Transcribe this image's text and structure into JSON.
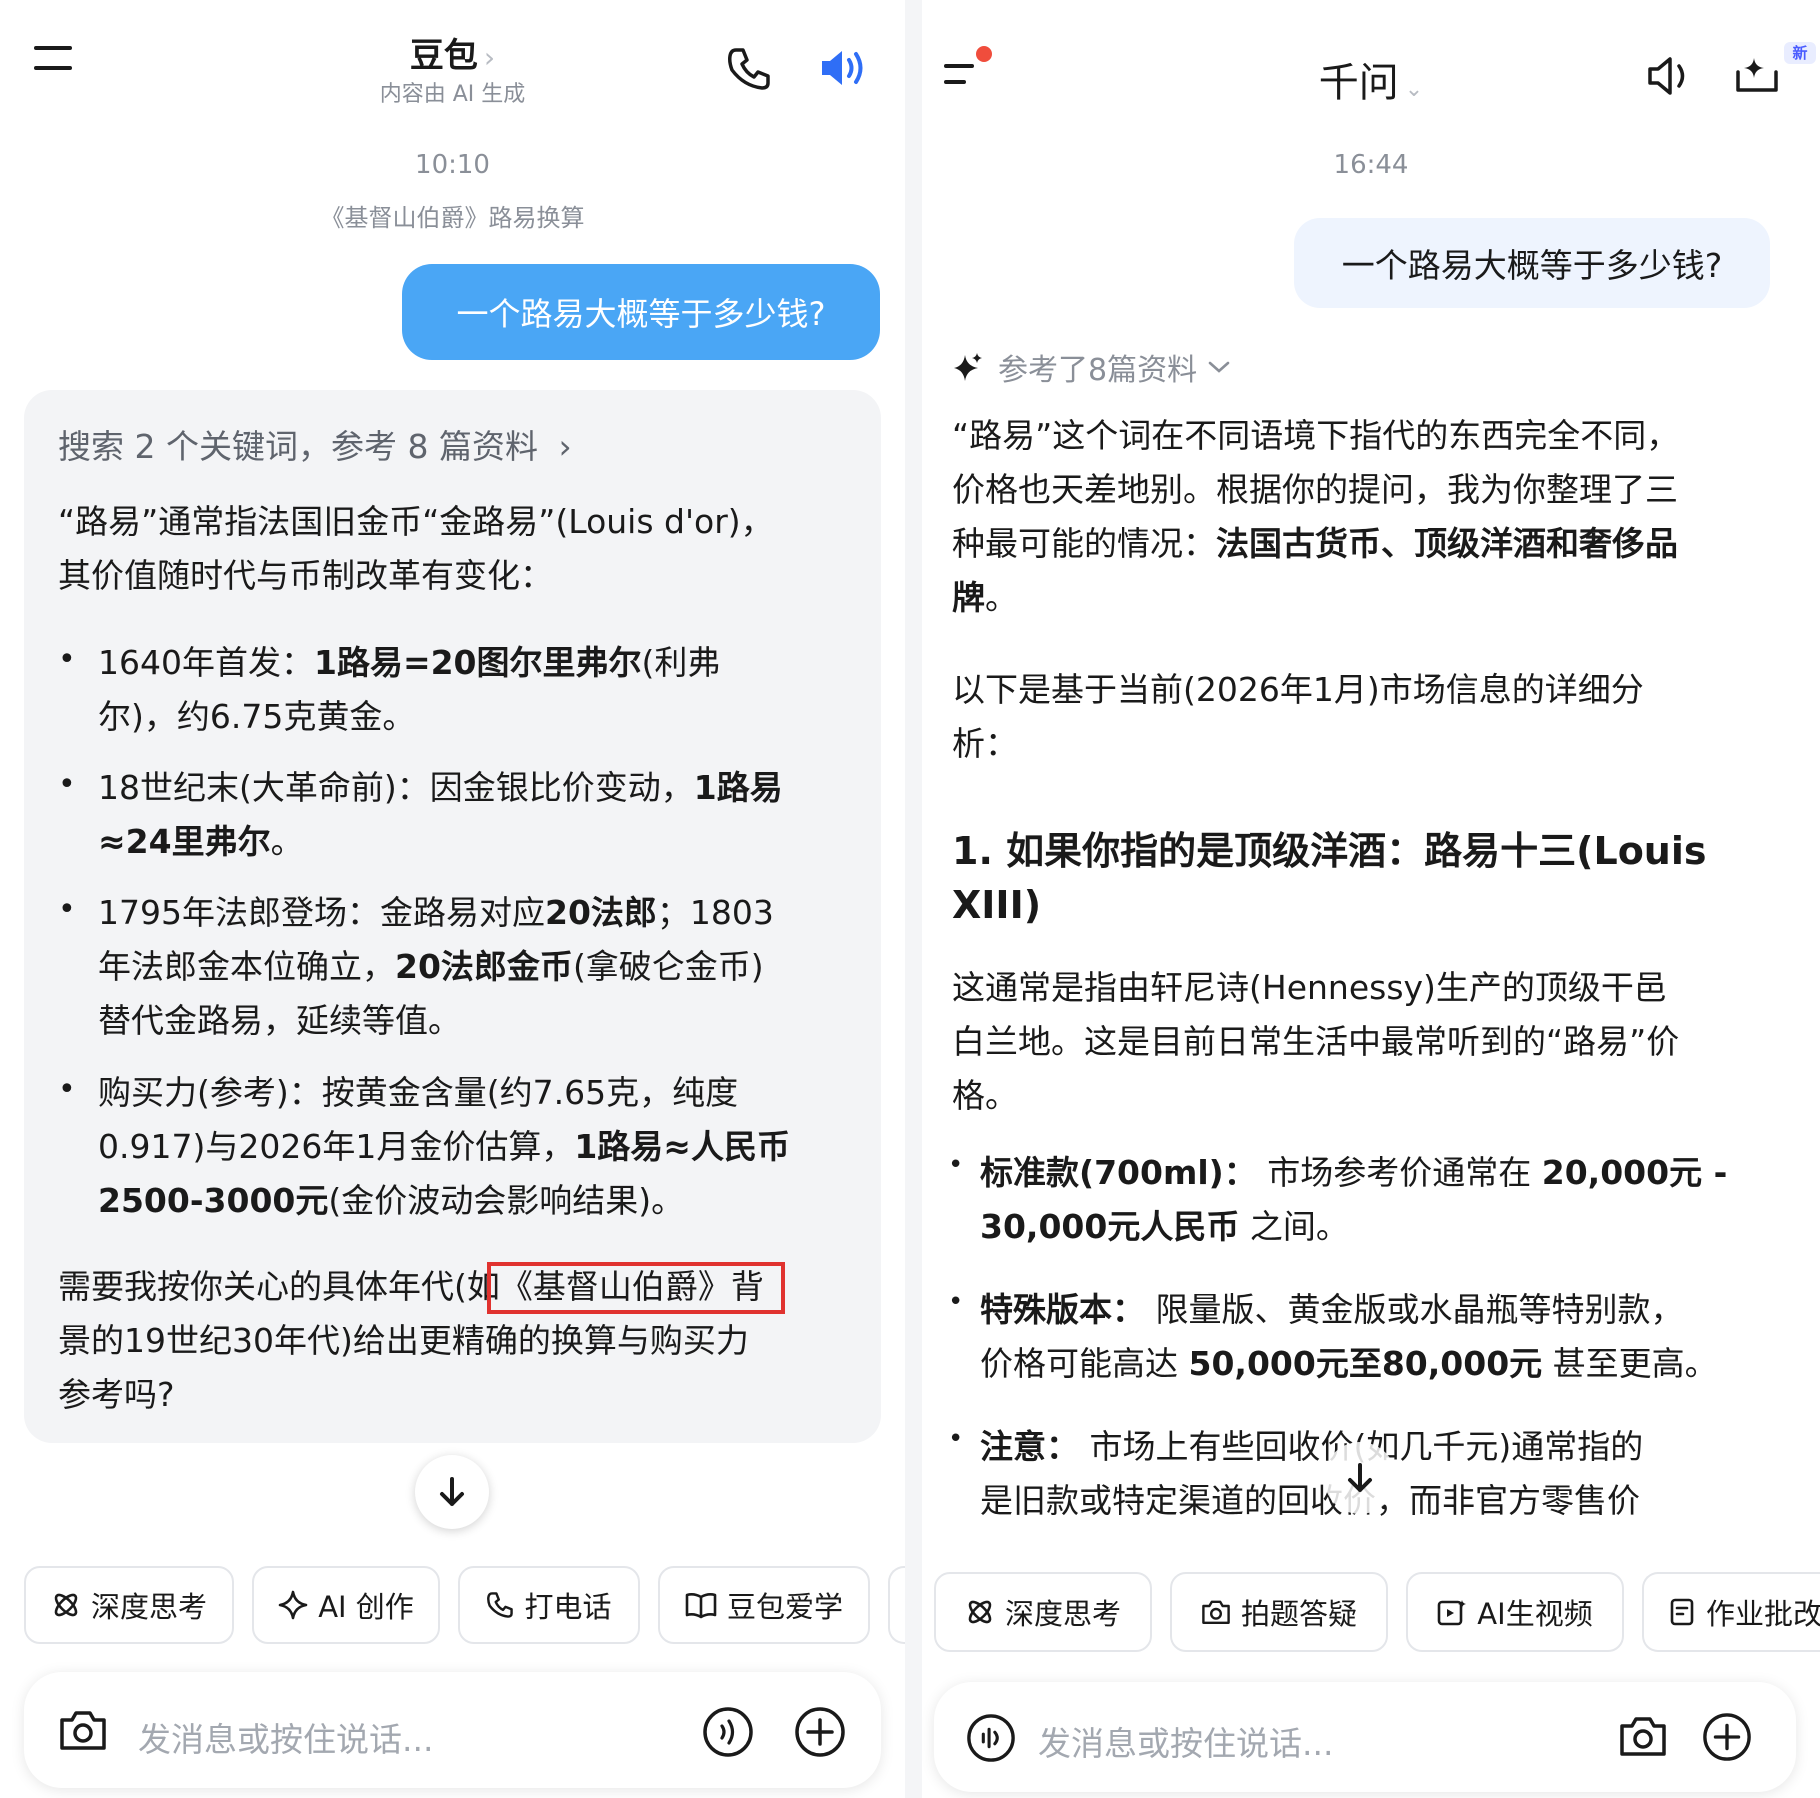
{
  "left": {
    "header": {
      "title": "豆包",
      "title_chevron": "›",
      "subtitle": "内容由 AI 生成"
    },
    "time": "10:10",
    "topic": "《基督山伯爵》路易换算",
    "user_message": "一个路易大概等于多少钱?",
    "reply": {
      "search_summary": "搜索 2 个关键词，参考 8 篇资料",
      "search_chevron": "›",
      "intro_line1": "“路易”通常指法国旧金币“金路易”(Louis d'or)，",
      "intro_line2": "其价值随时代与币制改革有变化：",
      "b1_l1_a": "1640年首发：",
      "b1_l1_b": "1路易=20图尔里弗尔",
      "b1_l1_c": "(利弗",
      "b1_l2": "尔)，约6.75克黄金。",
      "b2_l1_a": "18世纪末(大革命前)：因金银比价变动，",
      "b2_l1_b": "1路易",
      "b2_l2": "≈24里弗尔",
      "b2_l2_end": "。",
      "b3_l1_a": "1795年法郎登场：金路易对应",
      "b3_l1_b": "20法郎",
      "b3_l1_c": "；1803",
      "b3_l2_a": "年法郎金本位确立，",
      "b3_l2_b": "20法郎金币",
      "b3_l2_c": "(拿破仑金币)",
      "b3_l3": "替代金路易，延续等值。",
      "b4_l1": "购买力(参考)：按黄金含量(约7.65克，纯度",
      "b4_l2_a": "0.917)与2026年1月金价估算，",
      "b4_l2_b": "1路易≈人民币",
      "b4_l3_a": "2500-3000元",
      "b4_l3_b": "(金价波动会影响结果)。",
      "q_l1_a": "需要我按你关心的具体年代",
      "q_l1_b": "(如《基督山伯爵》",
      "q_l1_c": "背",
      "q_l2": "景的19世纪30年代)给出更精确的换算与购买力",
      "q_l3": "参考吗?"
    },
    "chips": [
      "深度思考",
      "AI 创作",
      "打电话",
      "豆包爱学"
    ],
    "input_placeholder": "发消息或按住说话..."
  },
  "right": {
    "header": {
      "title": "千问",
      "title_chevron": "⌄",
      "new_badge": "新"
    },
    "time": "16:44",
    "user_message": "一个路易大概等于多少钱?",
    "references": "参考了8篇资料",
    "reply": {
      "p1_l1": "“路易”这个词在不同语境下指代的东西完全不同，",
      "p1_l2": "价格也天差地别。根据你的提问，我为你整理了三",
      "p1_l3_a": "种最可能的情况：",
      "p1_l3_b": "法国古货币、顶级洋酒和奢侈品",
      "p1_l4_a": "牌",
      "p1_l4_b": "。",
      "p2_l1": "以下是基于当前(2026年1月)市场信息的详细分",
      "p2_l2": "析：",
      "h1_l1": "1. 如果你指的是顶级洋酒：路易十三(Louis",
      "h1_l2": "XIII)",
      "p3_l1": "这通常是指由轩尼诗(Hennessy)生产的顶级干邑",
      "p3_l2": "白兰地。这是目前日常生活中最常听到的“路易”价",
      "p3_l3": "格。",
      "b1_l1_a": "标准款(700ml)：",
      "b1_l1_b": " 市场参考价通常在 ",
      "b1_l1_c": "20,000元 -",
      "b1_l2_a": "30,000元人民币",
      "b1_l2_b": " 之间。",
      "b2_l1_a": "特殊版本：",
      "b2_l1_b": " 限量版、黄金版或水晶瓶等特别款，",
      "b2_l2_a": "价格可能高达 ",
      "b2_l2_b": "50,000元至80,000元",
      "b2_l2_c": " 甚至更高。",
      "b3_l1_a": "注意：",
      "b3_l1_b": " 市场上有些回收价(如几千元)通常指的",
      "b3_l2": "是旧款或特定渠道的回收价，而非官方零售价"
    },
    "chips": [
      "深度思考",
      "拍题答疑",
      "AI生视频",
      "作业批改"
    ],
    "input_placeholder": "发消息或按住说话..."
  },
  "colors": {
    "user_bubble_left": "#4aa6f5",
    "user_bubble_right": "#eef4fe",
    "reply_bg": "#f3f4f6",
    "highlight_border": "#e0322f",
    "speaker_active": "#2f6ef6",
    "notification_dot": "#f04d3c"
  },
  "icons": [
    "menu-icon",
    "phone-icon",
    "speaker-icon",
    "camera-icon",
    "voice-icon",
    "plus-icon",
    "sparkle-icon",
    "arrow-down-icon",
    "atom-icon",
    "book-icon",
    "video-icon",
    "homework-icon"
  ]
}
